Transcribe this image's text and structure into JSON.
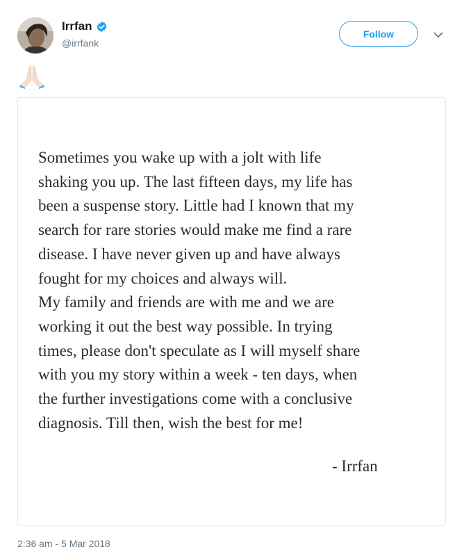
{
  "user": {
    "display_name": "Irrfan",
    "handle": "@irrfank",
    "verified": true
  },
  "header": {
    "follow_label": "Follow",
    "menu_icon": "chevron-down-icon"
  },
  "tweet": {
    "emoji": "🙏🏻",
    "timestamp": "2:36 am - 5 Mar 2018"
  },
  "image_text": {
    "lines": [
      "Sometimes you wake up with a jolt with life",
      "shaking you up. The last fifteen days, my life has",
      "been a suspense story. Little had I known that my",
      "search for rare stories would make me find a rare",
      "disease. I have never given up and have always",
      "fought for my choices and always will.",
      "My family and friends are with me and we are",
      "working it out the best way possible. In trying",
      "times, please don't speculate as I will myself share",
      "with you my story within a week - ten days, when",
      "the further investigations come with a conclusive",
      "diagnosis. Till then, wish the best for me!"
    ],
    "signature": "- Irrfan"
  },
  "colors": {
    "accent": "#1da1f2",
    "secondary_text": "#657786",
    "border": "#e1e8ed"
  }
}
